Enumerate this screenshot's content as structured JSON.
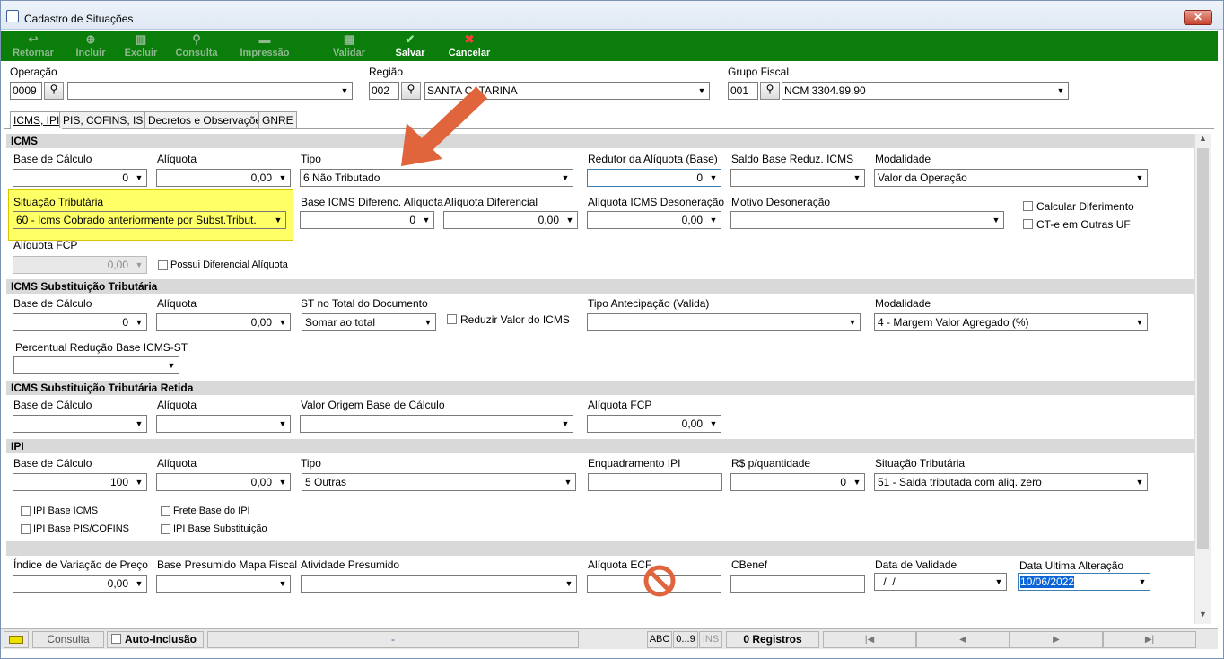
{
  "window": {
    "title": "Cadastro de Situações",
    "close": "✕"
  },
  "toolbar": {
    "retornar": "Retornar",
    "incluir": "Incluir",
    "excluir": "Excluir",
    "consulta": "Consulta",
    "impressao": "Impressão",
    "validar": "Validar",
    "salvar": "Salvar",
    "cancelar": "Cancelar"
  },
  "header": {
    "operacao_label": "Operação",
    "operacao_code": "0009",
    "operacao_desc": "",
    "regiao_label": "Região",
    "regiao_code": "002",
    "regiao_desc": "SANTA CATARINA",
    "grupo_label": "Grupo Fiscal",
    "grupo_code": "001",
    "grupo_desc": "NCM 3304.99.90"
  },
  "tabs": [
    "ICMS, IPI",
    "PIS, COFINS, ISS",
    "Decretos e Observações",
    "GNRE"
  ],
  "icms": {
    "title": "ICMS",
    "base_calculo_label": "Base de Cálculo",
    "base_calculo": "0",
    "aliquota_label": "Alíquota",
    "aliquota": "0,00",
    "tipo_label": "Tipo",
    "tipo": "6 Não Tributado",
    "redutor_label": "Redutor da Alíquota (Base)",
    "redutor": "0",
    "saldo_label": "Saldo Base Reduz. ICMS",
    "saldo": "",
    "modalidade_label": "Modalidade",
    "modalidade": "Valor da Operação",
    "situacao_label": "Situação Tributária",
    "situacao": "60 - Icms Cobrado anteriormente por Subst.Tribut.",
    "base_dif_label": "Base ICMS Diferenc. Alíquota",
    "base_dif": "0",
    "aliq_dif_label": "Alíquota Diferencial",
    "aliq_dif": "0,00",
    "aliq_deson_label": "Alíquota ICMS Desoneração",
    "aliq_deson": "0,00",
    "motivo_label": "Motivo Desoneração",
    "motivo": "",
    "calc_diferimento": "Calcular Diferimento",
    "cte_outras": "CT-e em Outras UF",
    "aliq_fcp_label": "Alíquota FCP",
    "aliq_fcp": "0,00",
    "possui_dif": "Possui Diferencial Alíquota"
  },
  "st": {
    "title": "ICMS Substituição Tributária",
    "base_label": "Base de Cálculo",
    "base": "0",
    "aliq_label": "Alíquota",
    "aliq": "0,00",
    "total_label": "ST no Total do Documento",
    "total": "Somar ao total",
    "reduzir": "Reduzir Valor do ICMS",
    "antecip_label": "Tipo Antecipação (Valida)",
    "antecip": "",
    "modalidade_label": "Modalidade",
    "modalidade": "4 - Margem Valor Agregado (%)",
    "perc_label": "Percentual Redução Base ICMS-ST",
    "perc": ""
  },
  "st_retida": {
    "title": "ICMS Substituição Tributária Retida",
    "base_label": "Base de Cálculo",
    "base": "",
    "aliq_label": "Alíquota",
    "aliq": "",
    "valor_label": "Valor Origem Base de Cálculo",
    "valor": "",
    "fcp_label": "Alíquota FCP",
    "fcp": "0,00"
  },
  "ipi": {
    "title": "IPI",
    "base_label": "Base de Cálculo",
    "base": "100",
    "aliq_label": "Alíquota",
    "aliq": "0,00",
    "tipo_label": "Tipo",
    "tipo": "5 Outras",
    "enq_label": "Enquadramento IPI",
    "enq": "",
    "rs_label": "R$ p/quantidade",
    "rs": "0",
    "sit_label": "Situação Tributária",
    "sit": "51 - Saida tributada com aliq. zero",
    "cb_base_icms": "IPI Base ICMS",
    "cb_frete": "Frete Base do IPI",
    "cb_pis": "IPI Base PIS/COFINS",
    "cb_subst": "IPI Base Substituição"
  },
  "outros": {
    "indice_label": "Índice de Variação de Preço",
    "indice": "0,00",
    "base_pres_label": "Base Presumido Mapa Fiscal",
    "base_pres": "",
    "ativ_label": "Atividade Presumido",
    "ativ": "",
    "aliq_ecf_label": "Alíquota ECF",
    "aliq_ecf": "",
    "cbenef_label": "CBenef",
    "cbenef": "",
    "validade_label": "Data de Validade",
    "validade": " /  /",
    "ultima_label": "Data Ultima Alteração",
    "ultima": "10/06/2022"
  },
  "status": {
    "consulta": "Consulta",
    "auto": "Auto-Inclusão",
    "dash": "-",
    "abc": "ABC",
    "num": "0...9",
    "ins": "INS",
    "registros": "0 Registros",
    "first": "|◀",
    "prev": "◀",
    "next": "▶",
    "last": "▶|"
  },
  "colors": {
    "toolbar": "#0a7d0a",
    "highlight": "#ffff66",
    "arrow": "#e0643c",
    "section": "#d9d9d9"
  }
}
